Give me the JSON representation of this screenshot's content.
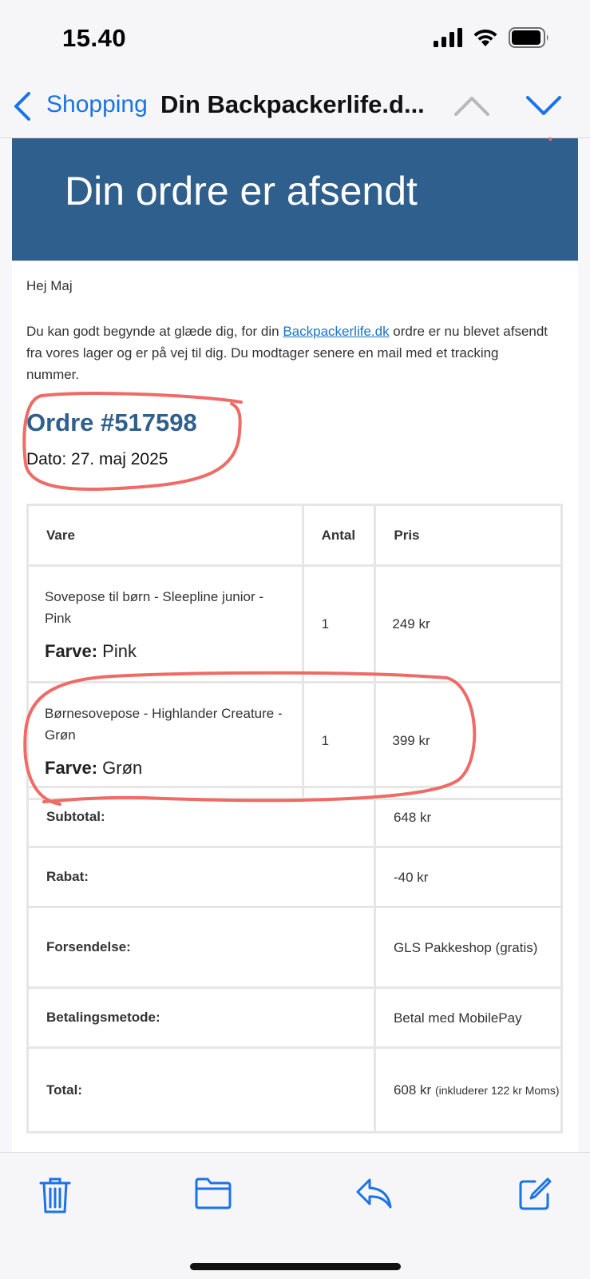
{
  "status_bar": {
    "time": "15.40"
  },
  "nav": {
    "back_label": "Shopping",
    "title": "Din Backpackerlife.d..."
  },
  "email": {
    "header_title": "Din ordre er afsendt",
    "greeting": "Hej Maj",
    "intro_before_link": "Du kan godt begynde at glæde dig, for din ",
    "intro_link": "Backpackerlife.dk",
    "intro_after_link": " ordre er nu blevet afsendt fra vores lager og er på vej til dig. Du modtager senere en mail med et tracking nummer.",
    "order_title": "Ordre #517598",
    "order_date": "Dato: 27. maj 2025",
    "table_headers": {
      "item": "Vare",
      "qty": "Antal",
      "price": "Pris"
    },
    "items": [
      {
        "name": "Sovepose til børn - Sleepline junior - Pink",
        "attr_label": "Farve:",
        "attr_value": "Pink",
        "qty": "1",
        "price": "249 kr"
      },
      {
        "name": "Børnesovepose - Highlander Creature - Grøn",
        "attr_label": "Farve:",
        "attr_value": "Grøn",
        "qty": "1",
        "price": "399 kr"
      }
    ],
    "totals": {
      "subtotal_label": "Subtotal:",
      "subtotal_value": "648 kr",
      "discount_label": "Rabat:",
      "discount_value": "-40 kr",
      "shipping_label": "Forsendelse:",
      "shipping_value": "GLS Pakkeshop (gratis)",
      "payment_label": "Betalingsmetode:",
      "payment_value": "Betal med MobilePay",
      "total_label": "Total:",
      "total_value": "608 kr",
      "total_note": "(inkluderer 122 kr Moms)"
    }
  },
  "colors": {
    "header_blue": "#2f5f8c",
    "ios_blue": "#1a73e8",
    "annotation_red": "#ee6b66"
  },
  "toolbar": {
    "icons": [
      "trash-icon",
      "folder-icon",
      "reply-icon",
      "compose-icon"
    ]
  }
}
